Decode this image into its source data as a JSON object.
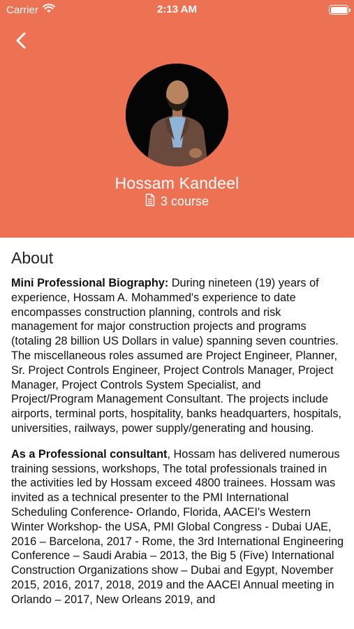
{
  "status_bar": {
    "carrier": "Carrier",
    "time": "2:13 AM"
  },
  "profile": {
    "name": "Hossam Kandeel",
    "course_count_label": "3 course"
  },
  "about": {
    "title": "About",
    "paragraph1_lead": "Mini Professional Biography:",
    "paragraph1_body": " During nineteen (19) years of experience, Hossam A. Mohammed's experience to date encompasses construction planning, controls and risk management for major construction projects and programs (totaling 28 billion US Dollars in value) spanning seven countries. The miscellaneous roles assumed are Project Engineer, Planner, Sr. Project Controls Engineer, Project Controls Manager, Project Manager, Project Controls System Specialist, and Project/Program Management Consultant. The projects include airports, terminal ports, hospitality, banks headquarters, hospitals, universities, railways, power supply/generating and housing.",
    "paragraph2_lead": "As a Professional consultant",
    "paragraph2_body": ", Hossam has delivered numerous training sessions, workshops, The total professionals trained in the activities led by Hossam exceed 4800 trainees. Hossam was invited as a technical presenter to the PMI International Scheduling Conference- Orlando, Florida, AACEI's Western Winter Workshop- the USA, PMI Global Congress - Dubai UAE, 2016 – Barcelona, 2017 - Rome, the 3rd International Engineering Conference – Saudi Arabia – 2013, the Big 5 (Five) International Construction Organizations show – Dubai and Egypt, November 2015, 2016, 2017, 2018, 2019 and the AACEI Annual meeting in Orlando – 2017, New Orleans 2019, and"
  },
  "colors": {
    "header_background": "#ed7153",
    "header_text": "#ffffff",
    "body_text": "#111111"
  },
  "icons": {
    "back": "chevron-left-icon",
    "wifi": "wifi-icon",
    "battery": "battery-icon",
    "course": "document-icon"
  }
}
